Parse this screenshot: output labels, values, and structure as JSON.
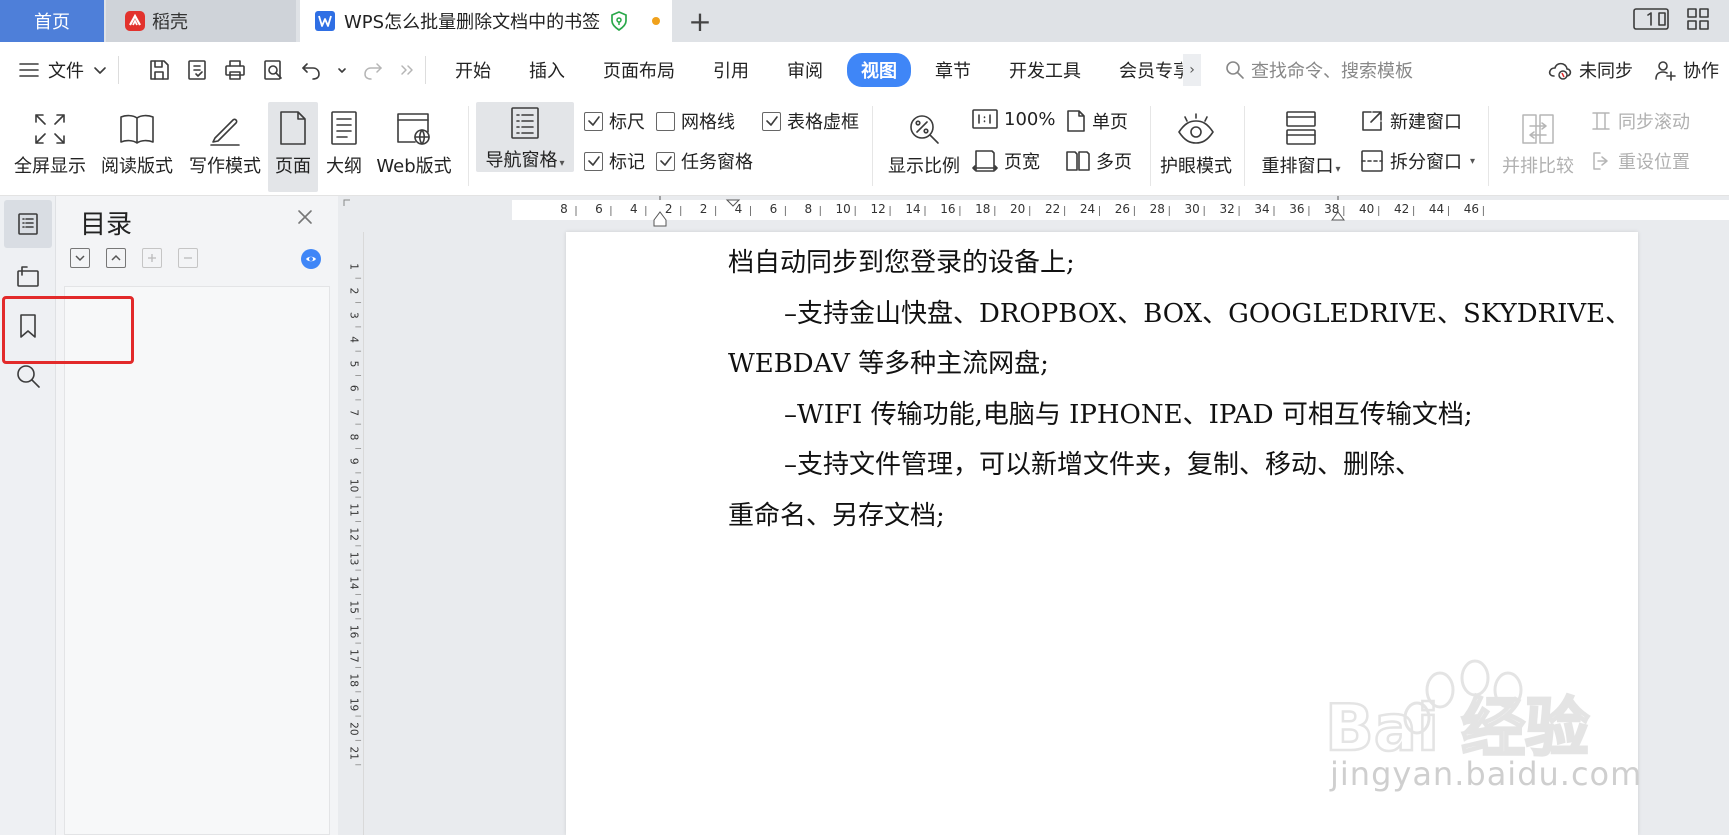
{
  "tabs": {
    "home": "首页",
    "daoke": "稻壳",
    "document": "WPS怎么批量删除文档中的书签",
    "add": "+"
  },
  "menu": {
    "file": "文件",
    "tabs": [
      "开始",
      "插入",
      "页面布局",
      "引用",
      "审阅",
      "视图",
      "章节",
      "开发工具",
      "会员专享"
    ],
    "active_tab": "视图",
    "search_placeholder": "查找命令、搜索模板",
    "sync": "未同步",
    "collab": "协作"
  },
  "ribbon": {
    "fullscreen": "全屏显示",
    "reading": "阅读版式",
    "writing": "写作模式",
    "page": "页面",
    "outline": "大纲",
    "web": "Web版式",
    "nav_pane": "导航窗格",
    "ruler": "标尺",
    "gridlines": "网格线",
    "table_gridlines": "表格虚框",
    "marks": "标记",
    "task_pane": "任务窗格",
    "zoom": "显示比例",
    "zoom_100": "100%",
    "page_width": "页宽",
    "single_page": "单页",
    "multi_page": "多页",
    "eye_care": "护眼模式",
    "rearrange": "重排窗口",
    "new_window": "新建窗口",
    "split_window": "拆分窗口",
    "side_by_side": "并排比较",
    "sync_scroll": "同步滚动",
    "reset_position": "重设位置",
    "checked": {
      "ruler": true,
      "gridlines": false,
      "table_gridlines": true,
      "marks": true,
      "task_pane": true
    }
  },
  "nav_panel": {
    "title": "目录"
  },
  "ruler": {
    "h_labels": [
      "8",
      "6",
      "4",
      "2",
      "2",
      "4",
      "6",
      "8",
      "10",
      "12",
      "14",
      "16",
      "18",
      "20",
      "22",
      "24",
      "26",
      "28",
      "30",
      "32",
      "34",
      "36",
      "38",
      "40",
      "42",
      "44",
      "46"
    ],
    "v_labels": [
      "1",
      "2",
      "3",
      "4",
      "5",
      "6",
      "7",
      "8",
      "9",
      "10",
      "11",
      "12",
      "13",
      "14",
      "15",
      "16",
      "17",
      "18",
      "19",
      "20",
      "21"
    ]
  },
  "document": {
    "lines": [
      {
        "text": "档自动同步到您登录的设备上;",
        "indent": false
      },
      {
        "text": "–支持金山快盘、DROPBOX、BOX、GOOGLEDRIVE、SKYDRIVE、",
        "indent": true
      },
      {
        "text": "WEBDAV 等多种主流网盘;",
        "indent": false
      },
      {
        "text": "–WIFI 传输功能,电脑与 IPHONE、IPAD 可相互传输文档;",
        "indent": true
      },
      {
        "text": "–支持文件管理，可以新增文件夹，复制、移动、删除、",
        "indent": true
      },
      {
        "text": "重命名、另存文档;",
        "indent": false
      }
    ]
  },
  "watermark": {
    "brand": "Bai 经验",
    "url": "jingyan.baidu.com"
  },
  "colors": {
    "accent": "#3f86f7",
    "home_tab": "#4e7fd9",
    "highlight_box": "#e22a2a",
    "modified_dot": "#f0a11c"
  }
}
